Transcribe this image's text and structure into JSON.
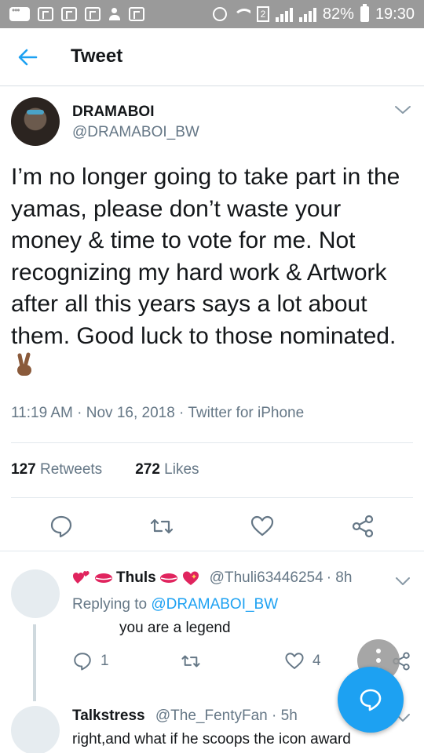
{
  "status_bar": {
    "battery": "82%",
    "time": "19:30",
    "sim_number": "2"
  },
  "header": {
    "title": "Tweet"
  },
  "tweet": {
    "author_name": "DRAMABOI",
    "author_handle": "@DRAMABOI_BW",
    "text": "I’m no longer going to take part in the yamas, please don’t waste your money & time to vote for me. Not recognizing my hard work & Artwork after all this years says a lot about them. Good luck to those nominated.",
    "timestamp": "11:19 AM · Nov 16, 2018 · Twitter for iPhone",
    "retweets_count": "127",
    "retweets_label": "Retweets",
    "likes_count": "272",
    "likes_label": "Likes"
  },
  "replies": [
    {
      "name": "Thuls",
      "handle": "@Thuli63446254",
      "time": "· 8h",
      "replying_prefix": "Replying to",
      "replying_to": "@DRAMABOI_BW",
      "text": "you are a legend",
      "reply_count": "1",
      "like_count": "4"
    },
    {
      "name": "Talkstress",
      "handle": "@The_FentyFan",
      "time": "· 5h",
      "text": "right,and what if he scoops the icon award"
    }
  ],
  "colors": {
    "accent": "#1da1f2",
    "secondary_text": "#657786",
    "status_bar": "#9a9a9a"
  },
  "icons": {
    "back": "arrow-left-icon",
    "chevron": "chevron-down-icon",
    "reply": "reply-icon",
    "retweet": "retweet-icon",
    "like": "heart-icon",
    "share": "share-icon",
    "compose": "compose-reply-icon",
    "more": "more-vertical-icon"
  }
}
